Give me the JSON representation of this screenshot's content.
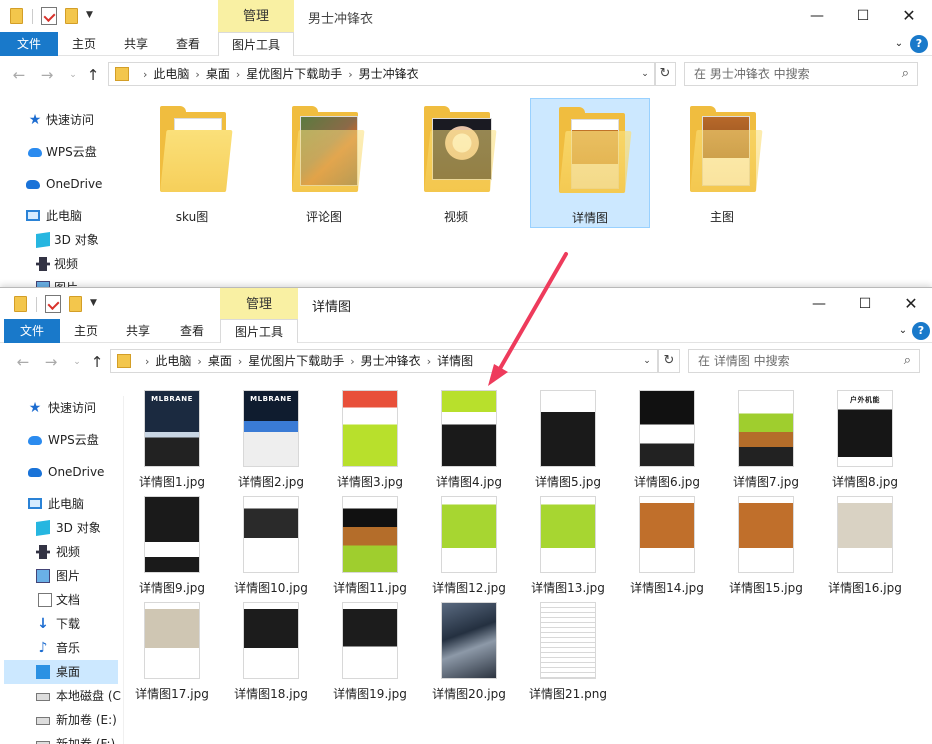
{
  "window1": {
    "title": "男士冲锋衣",
    "context_group": "管理",
    "tabs": {
      "file": "文件",
      "home": "主页",
      "share": "共享",
      "view": "查看",
      "tools": "图片工具"
    },
    "breadcrumb": [
      "此电脑",
      "桌面",
      "星优图片下载助手",
      "男士冲锋衣"
    ],
    "search_placeholder": "在 男士冲锋衣 中搜索",
    "nav": {
      "quick_access": "快速访问",
      "wps": "WPS云盘",
      "onedrive": "OneDrive",
      "this_pc": "此电脑",
      "objects3d": "3D 对象",
      "videos": "视频",
      "pictures": "图片"
    },
    "folders": [
      {
        "label": "sku图"
      },
      {
        "label": "评论图"
      },
      {
        "label": "视频"
      },
      {
        "label": "详情图",
        "selected": true
      },
      {
        "label": "主图"
      }
    ]
  },
  "window2": {
    "title": "详情图",
    "context_group": "管理",
    "tabs": {
      "file": "文件",
      "home": "主页",
      "share": "共享",
      "view": "查看",
      "tools": "图片工具"
    },
    "breadcrumb": [
      "此电脑",
      "桌面",
      "星优图片下载助手",
      "男士冲锋衣",
      "详情图"
    ],
    "search_placeholder": "在 详情图 中搜索",
    "nav": {
      "quick_access": "快速访问",
      "wps": "WPS云盘",
      "onedrive": "OneDrive",
      "this_pc": "此电脑",
      "objects3d": "3D 对象",
      "videos": "视频",
      "pictures": "图片",
      "documents": "文档",
      "downloads": "下载",
      "music": "音乐",
      "desktop": "桌面",
      "local_disk": "本地磁盘 (C",
      "vol_e": "新加卷 (E:)",
      "vol_f": "新加卷 (F:)"
    },
    "files": [
      {
        "name": "详情图1.jpg",
        "style": "store",
        "text": "MLBRANE"
      },
      {
        "name": "详情图2.jpg",
        "style": "store2",
        "text": "MLBRANE"
      },
      {
        "name": "详情图3.jpg",
        "style": "lime",
        "text": ""
      },
      {
        "name": "详情图4.jpg",
        "style": "limedark",
        "text": ""
      },
      {
        "name": "详情图5.jpg",
        "style": "darkinfo",
        "text": ""
      },
      {
        "name": "详情图6.jpg",
        "style": "darkrack",
        "text": ""
      },
      {
        "name": "详情图7.jpg",
        "style": "colors",
        "text": ""
      },
      {
        "name": "详情图8.jpg",
        "style": "black",
        "text": "户外机能"
      },
      {
        "name": "详情图9.jpg",
        "style": "black2",
        "text": ""
      },
      {
        "name": "详情图10.jpg",
        "style": "black3",
        "text": ""
      },
      {
        "name": "详情图11.jpg",
        "style": "colors2",
        "text": ""
      },
      {
        "name": "详情图12.jpg",
        "style": "lime2",
        "text": ""
      },
      {
        "name": "详情图13.jpg",
        "style": "lime2",
        "text": ""
      },
      {
        "name": "详情图14.jpg",
        "style": "orange",
        "text": ""
      },
      {
        "name": "详情图15.jpg",
        "style": "orange",
        "text": ""
      },
      {
        "name": "详情图16.jpg",
        "style": "beige",
        "text": ""
      },
      {
        "name": "详情图17.jpg",
        "style": "beige2",
        "text": ""
      },
      {
        "name": "详情图18.jpg",
        "style": "black4",
        "text": ""
      },
      {
        "name": "详情图19.jpg",
        "style": "black5",
        "text": ""
      },
      {
        "name": "详情图20.jpg",
        "style": "photo",
        "text": ""
      },
      {
        "name": "详情图21.png",
        "style": "textdoc",
        "text": ""
      }
    ]
  },
  "colors": {
    "accent": "#1979ca",
    "context_tab": "#f9f0a3",
    "selection": "#cce8ff",
    "arrow": "#ee3b5c"
  }
}
